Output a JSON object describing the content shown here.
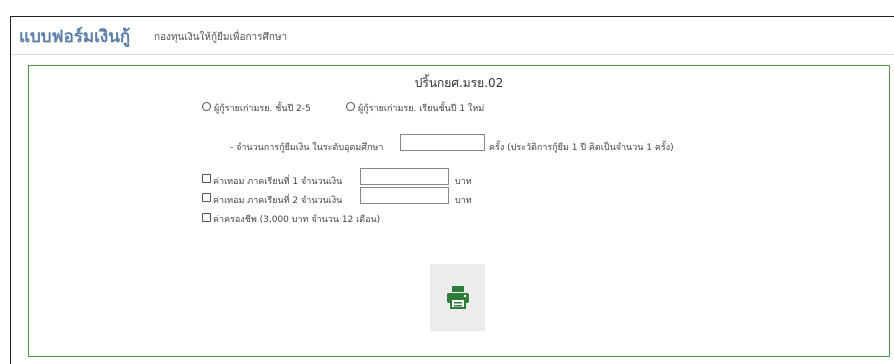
{
  "header": {
    "title": "แบบฟอร์มเงินกู้",
    "subtitle": "กองทุนเงินให้กู้ยืมเพื่อการศึกษา"
  },
  "form": {
    "title": "ปริ้นกยศ.มรย.02",
    "radio_options": [
      "ผู้กู้รายเก่ามรย. ชั้นปี 2-5",
      "ผู้กู้รายเก่ามรย. เรียนชั้นปี 1 ใหม่"
    ],
    "loan_count": {
      "label": "- จำนวนการกู้ยืมเงิน ในระดับอุดมศึกษา",
      "value": "",
      "suffix": "ครั้ง (ประวัติการกู้ยืม 1 ปี คิดเป็นจำนวน 1 ครั้ง)"
    },
    "checkboxes": [
      {
        "label": "ค่าเทอม ภาคเรียนที่ 1 จำนวนเงิน",
        "value": "",
        "unit": "บาท"
      },
      {
        "label": "ค่าเทอม ภาคเรียนที่ 2 จำนวนเงิน",
        "value": "",
        "unit": "บาท"
      },
      {
        "label": "ค่าครองชีพ (3,000 บาท จำนวน 12 เดือน)"
      }
    ],
    "print_icon": "printer-icon",
    "colors": {
      "header_title": "#5b7ea8",
      "panel_border": "#4a9a4a",
      "print_icon": "#2e7d3a"
    }
  }
}
